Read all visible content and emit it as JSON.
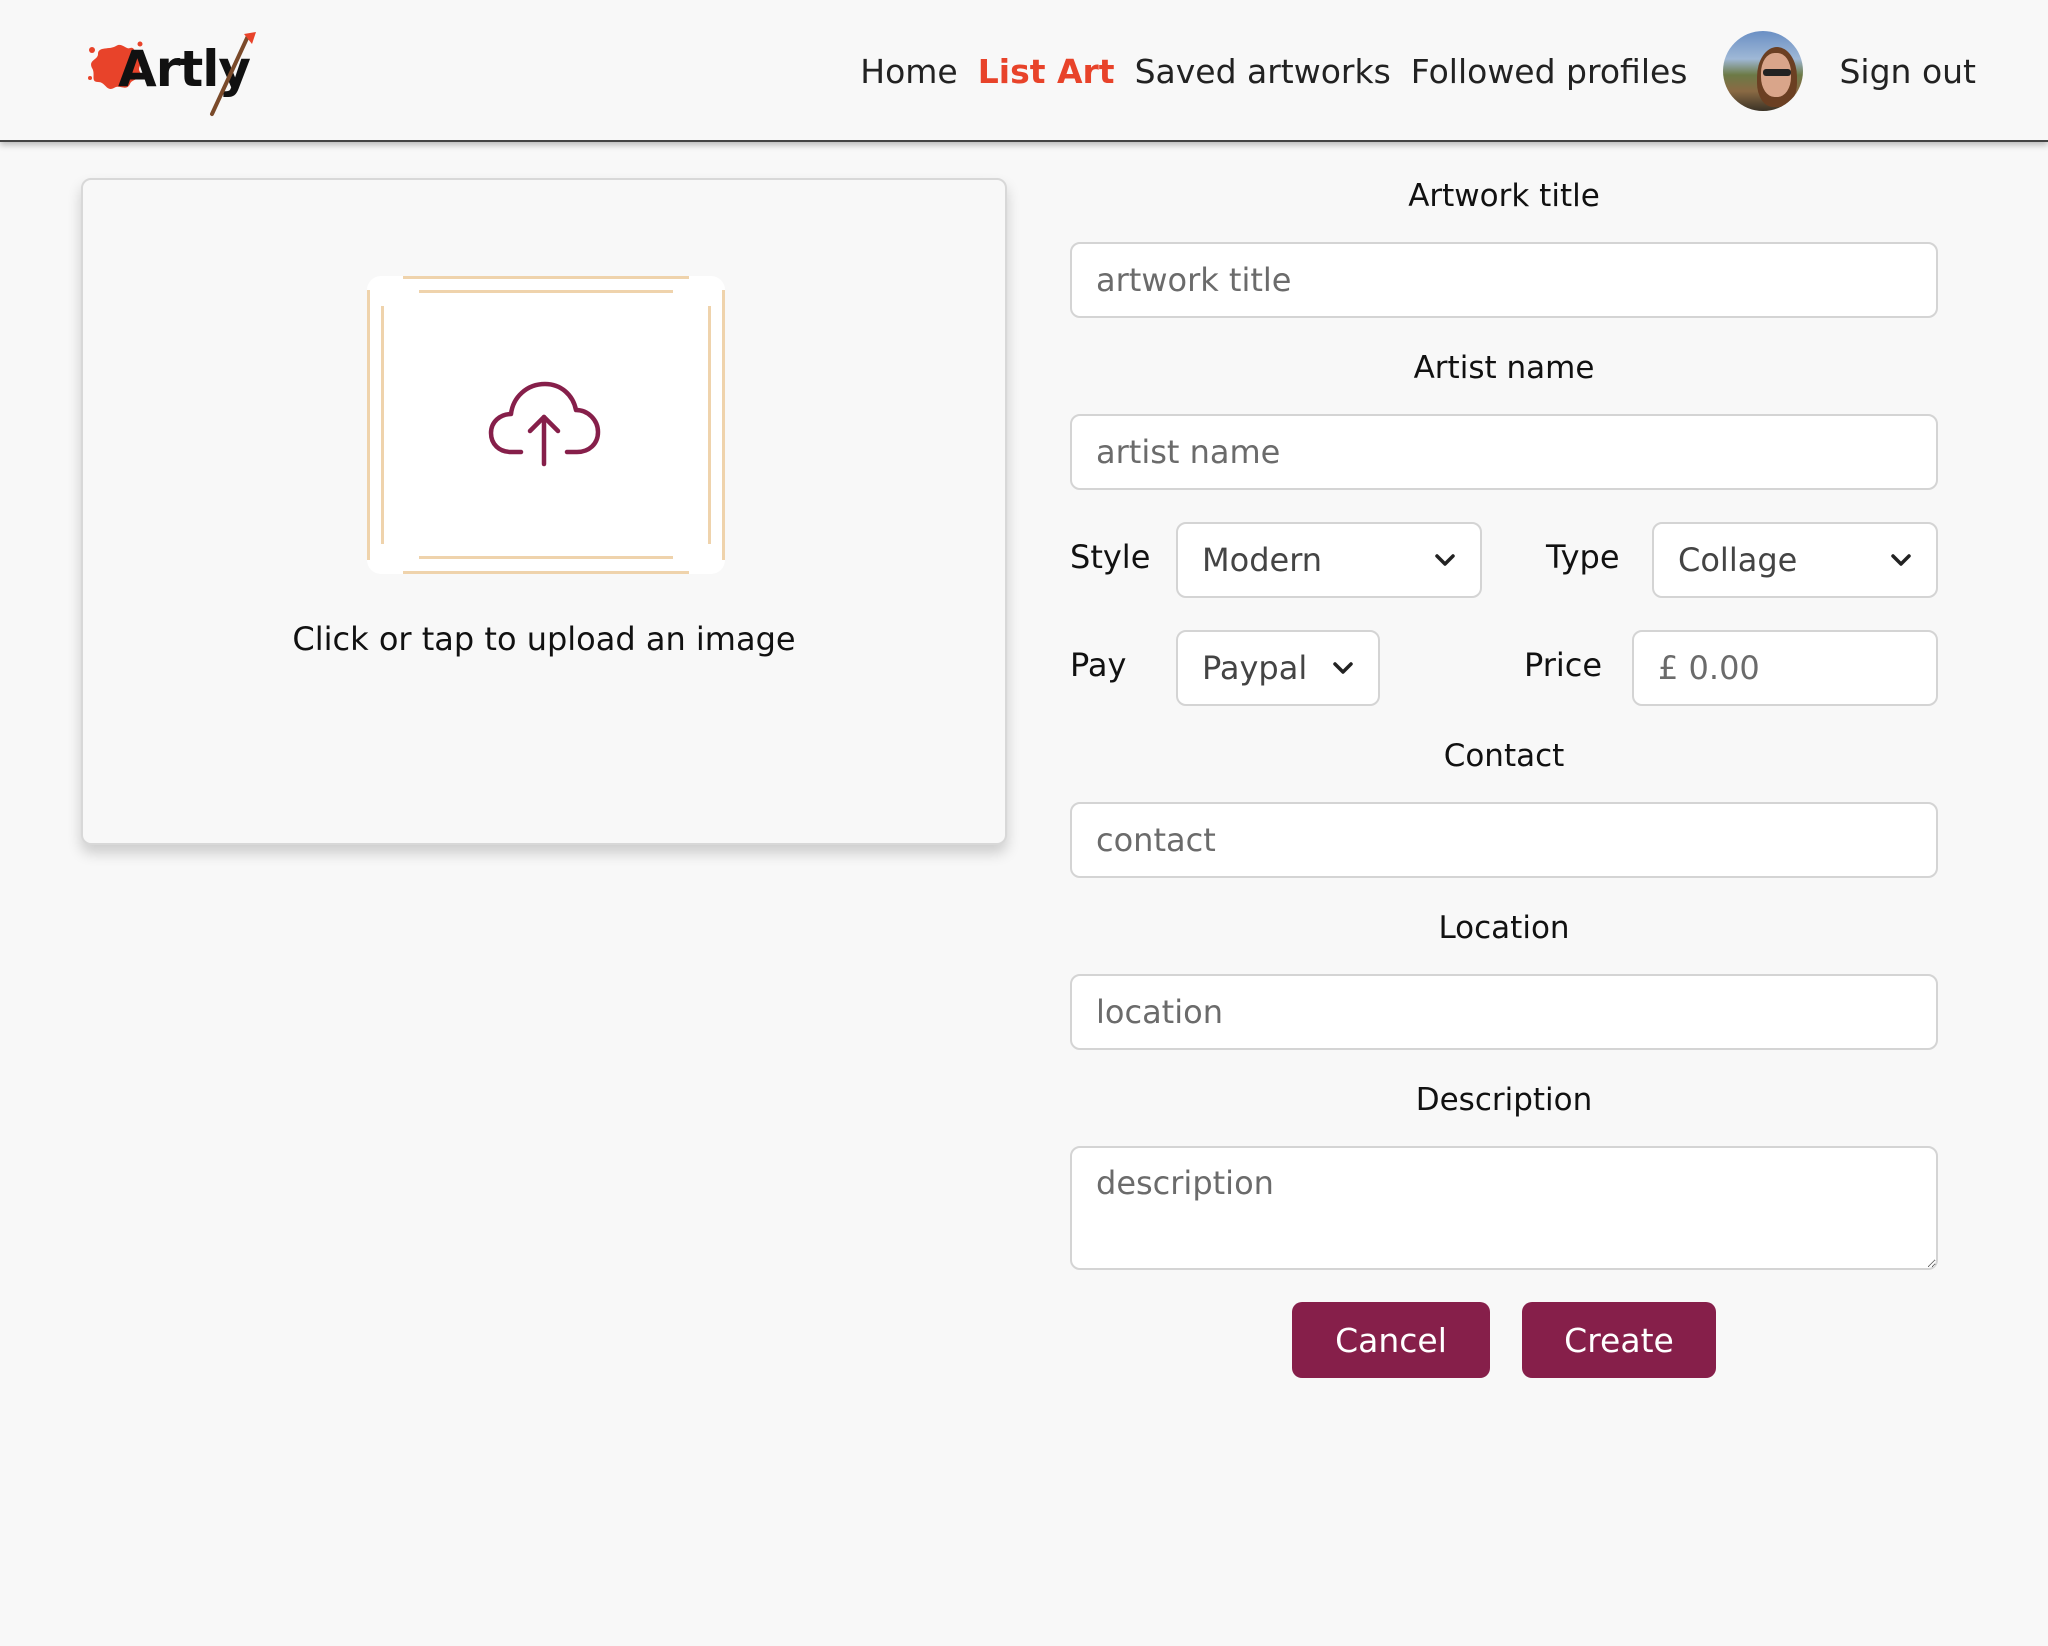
{
  "brand": {
    "name": "Artly",
    "accent_color": "#e8432a",
    "primary_color": "#861f4a"
  },
  "nav": {
    "links": [
      {
        "label": "Home",
        "active": false
      },
      {
        "label": "List Art",
        "active": true
      },
      {
        "label": "Saved artworks",
        "active": false
      },
      {
        "label": "Followed profiles",
        "active": false
      }
    ],
    "avatar": "user-avatar",
    "signout_label": "Sign out"
  },
  "upload": {
    "icon": "cloud-upload-icon",
    "prompt": "Click or tap to upload an image"
  },
  "form": {
    "title": {
      "label": "Artwork title",
      "placeholder": "artwork title",
      "value": ""
    },
    "artist": {
      "label": "Artist name",
      "placeholder": "artist name",
      "value": ""
    },
    "style": {
      "label": "Style",
      "selected": "Modern"
    },
    "type": {
      "label": "Type",
      "selected": "Collage"
    },
    "pay": {
      "label": "Pay",
      "selected": "Paypal"
    },
    "price": {
      "label": "Price",
      "placeholder": "£ 0.00",
      "value": ""
    },
    "contact": {
      "label": "Contact",
      "placeholder": "contact",
      "value": ""
    },
    "location": {
      "label": "Location",
      "placeholder": "location",
      "value": ""
    },
    "description": {
      "label": "Description",
      "placeholder": "description",
      "value": ""
    }
  },
  "actions": {
    "cancel_label": "Cancel",
    "create_label": "Create"
  }
}
